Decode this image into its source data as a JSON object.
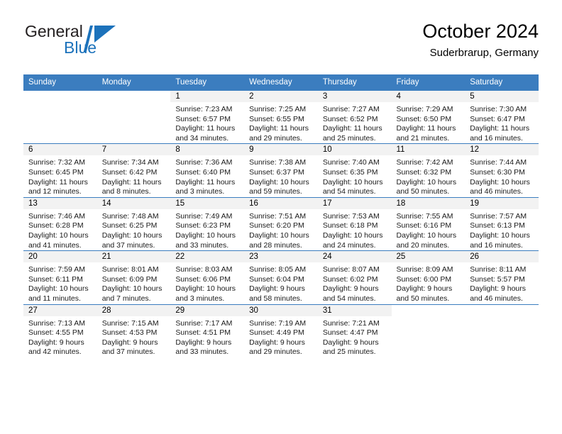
{
  "brand": {
    "name_part1": "General",
    "name_part2": "Blue",
    "logo_icon": "triangle-flag-icon",
    "color_blue": "#1c72bb",
    "color_dark": "#231f20"
  },
  "header": {
    "title": "October 2024",
    "subtitle": "Suderbrarup, Germany"
  },
  "theme": {
    "header_bg": "#3b7dbf",
    "header_text": "#ffffff",
    "daynum_band_bg": "#f2f2f2",
    "grid_line": "#3b7dbf"
  },
  "calendar": {
    "weekday_headers": [
      "Sunday",
      "Monday",
      "Tuesday",
      "Wednesday",
      "Thursday",
      "Friday",
      "Saturday"
    ],
    "weeks": [
      [
        {
          "day": "",
          "empty": true
        },
        {
          "day": "",
          "empty": true
        },
        {
          "day": "1",
          "sunrise": "Sunrise: 7:23 AM",
          "sunset": "Sunset: 6:57 PM",
          "daylight_line1": "Daylight: 11 hours",
          "daylight_line2": "and 34 minutes."
        },
        {
          "day": "2",
          "sunrise": "Sunrise: 7:25 AM",
          "sunset": "Sunset: 6:55 PM",
          "daylight_line1": "Daylight: 11 hours",
          "daylight_line2": "and 29 minutes."
        },
        {
          "day": "3",
          "sunrise": "Sunrise: 7:27 AM",
          "sunset": "Sunset: 6:52 PM",
          "daylight_line1": "Daylight: 11 hours",
          "daylight_line2": "and 25 minutes."
        },
        {
          "day": "4",
          "sunrise": "Sunrise: 7:29 AM",
          "sunset": "Sunset: 6:50 PM",
          "daylight_line1": "Daylight: 11 hours",
          "daylight_line2": "and 21 minutes."
        },
        {
          "day": "5",
          "sunrise": "Sunrise: 7:30 AM",
          "sunset": "Sunset: 6:47 PM",
          "daylight_line1": "Daylight: 11 hours",
          "daylight_line2": "and 16 minutes."
        }
      ],
      [
        {
          "day": "6",
          "sunrise": "Sunrise: 7:32 AM",
          "sunset": "Sunset: 6:45 PM",
          "daylight_line1": "Daylight: 11 hours",
          "daylight_line2": "and 12 minutes."
        },
        {
          "day": "7",
          "sunrise": "Sunrise: 7:34 AM",
          "sunset": "Sunset: 6:42 PM",
          "daylight_line1": "Daylight: 11 hours",
          "daylight_line2": "and 8 minutes."
        },
        {
          "day": "8",
          "sunrise": "Sunrise: 7:36 AM",
          "sunset": "Sunset: 6:40 PM",
          "daylight_line1": "Daylight: 11 hours",
          "daylight_line2": "and 3 minutes."
        },
        {
          "day": "9",
          "sunrise": "Sunrise: 7:38 AM",
          "sunset": "Sunset: 6:37 PM",
          "daylight_line1": "Daylight: 10 hours",
          "daylight_line2": "and 59 minutes."
        },
        {
          "day": "10",
          "sunrise": "Sunrise: 7:40 AM",
          "sunset": "Sunset: 6:35 PM",
          "daylight_line1": "Daylight: 10 hours",
          "daylight_line2": "and 54 minutes."
        },
        {
          "day": "11",
          "sunrise": "Sunrise: 7:42 AM",
          "sunset": "Sunset: 6:32 PM",
          "daylight_line1": "Daylight: 10 hours",
          "daylight_line2": "and 50 minutes."
        },
        {
          "day": "12",
          "sunrise": "Sunrise: 7:44 AM",
          "sunset": "Sunset: 6:30 PM",
          "daylight_line1": "Daylight: 10 hours",
          "daylight_line2": "and 46 minutes."
        }
      ],
      [
        {
          "day": "13",
          "sunrise": "Sunrise: 7:46 AM",
          "sunset": "Sunset: 6:28 PM",
          "daylight_line1": "Daylight: 10 hours",
          "daylight_line2": "and 41 minutes."
        },
        {
          "day": "14",
          "sunrise": "Sunrise: 7:48 AM",
          "sunset": "Sunset: 6:25 PM",
          "daylight_line1": "Daylight: 10 hours",
          "daylight_line2": "and 37 minutes."
        },
        {
          "day": "15",
          "sunrise": "Sunrise: 7:49 AM",
          "sunset": "Sunset: 6:23 PM",
          "daylight_line1": "Daylight: 10 hours",
          "daylight_line2": "and 33 minutes."
        },
        {
          "day": "16",
          "sunrise": "Sunrise: 7:51 AM",
          "sunset": "Sunset: 6:20 PM",
          "daylight_line1": "Daylight: 10 hours",
          "daylight_line2": "and 28 minutes."
        },
        {
          "day": "17",
          "sunrise": "Sunrise: 7:53 AM",
          "sunset": "Sunset: 6:18 PM",
          "daylight_line1": "Daylight: 10 hours",
          "daylight_line2": "and 24 minutes."
        },
        {
          "day": "18",
          "sunrise": "Sunrise: 7:55 AM",
          "sunset": "Sunset: 6:16 PM",
          "daylight_line1": "Daylight: 10 hours",
          "daylight_line2": "and 20 minutes."
        },
        {
          "day": "19",
          "sunrise": "Sunrise: 7:57 AM",
          "sunset": "Sunset: 6:13 PM",
          "daylight_line1": "Daylight: 10 hours",
          "daylight_line2": "and 16 minutes."
        }
      ],
      [
        {
          "day": "20",
          "sunrise": "Sunrise: 7:59 AM",
          "sunset": "Sunset: 6:11 PM",
          "daylight_line1": "Daylight: 10 hours",
          "daylight_line2": "and 11 minutes."
        },
        {
          "day": "21",
          "sunrise": "Sunrise: 8:01 AM",
          "sunset": "Sunset: 6:09 PM",
          "daylight_line1": "Daylight: 10 hours",
          "daylight_line2": "and 7 minutes."
        },
        {
          "day": "22",
          "sunrise": "Sunrise: 8:03 AM",
          "sunset": "Sunset: 6:06 PM",
          "daylight_line1": "Daylight: 10 hours",
          "daylight_line2": "and 3 minutes."
        },
        {
          "day": "23",
          "sunrise": "Sunrise: 8:05 AM",
          "sunset": "Sunset: 6:04 PM",
          "daylight_line1": "Daylight: 9 hours",
          "daylight_line2": "and 58 minutes."
        },
        {
          "day": "24",
          "sunrise": "Sunrise: 8:07 AM",
          "sunset": "Sunset: 6:02 PM",
          "daylight_line1": "Daylight: 9 hours",
          "daylight_line2": "and 54 minutes."
        },
        {
          "day": "25",
          "sunrise": "Sunrise: 8:09 AM",
          "sunset": "Sunset: 6:00 PM",
          "daylight_line1": "Daylight: 9 hours",
          "daylight_line2": "and 50 minutes."
        },
        {
          "day": "26",
          "sunrise": "Sunrise: 8:11 AM",
          "sunset": "Sunset: 5:57 PM",
          "daylight_line1": "Daylight: 9 hours",
          "daylight_line2": "and 46 minutes."
        }
      ],
      [
        {
          "day": "27",
          "sunrise": "Sunrise: 7:13 AM",
          "sunset": "Sunset: 4:55 PM",
          "daylight_line1": "Daylight: 9 hours",
          "daylight_line2": "and 42 minutes."
        },
        {
          "day": "28",
          "sunrise": "Sunrise: 7:15 AM",
          "sunset": "Sunset: 4:53 PM",
          "daylight_line1": "Daylight: 9 hours",
          "daylight_line2": "and 37 minutes."
        },
        {
          "day": "29",
          "sunrise": "Sunrise: 7:17 AM",
          "sunset": "Sunset: 4:51 PM",
          "daylight_line1": "Daylight: 9 hours",
          "daylight_line2": "and 33 minutes."
        },
        {
          "day": "30",
          "sunrise": "Sunrise: 7:19 AM",
          "sunset": "Sunset: 4:49 PM",
          "daylight_line1": "Daylight: 9 hours",
          "daylight_line2": "and 29 minutes."
        },
        {
          "day": "31",
          "sunrise": "Sunrise: 7:21 AM",
          "sunset": "Sunset: 4:47 PM",
          "daylight_line1": "Daylight: 9 hours",
          "daylight_line2": "and 25 minutes."
        },
        {
          "day": "",
          "empty": true
        },
        {
          "day": "",
          "empty": true
        }
      ]
    ]
  }
}
